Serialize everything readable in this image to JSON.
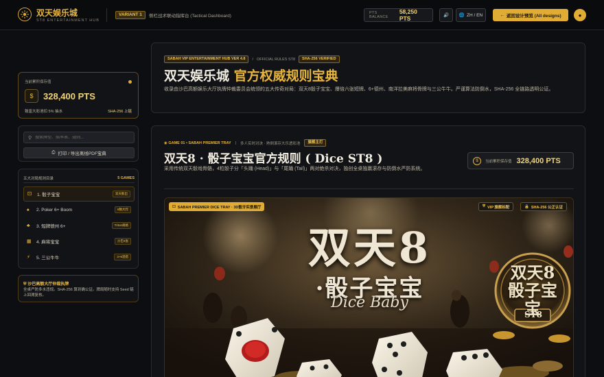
{
  "topbar": {
    "brand_title": "双天娱乐城",
    "brand_sub": "ST8 ENTERTAINMENT HUB",
    "variant": "VARIANT 1",
    "variant_desc": "侧栏战术联动指挥台 (Tactical Dashboard)",
    "balance_label": "PTS BALANCE",
    "balance_value": "58,250 PTS",
    "lang_label": "ZH / EN",
    "back_label": "返回设计预览 (All designs)"
  },
  "sidebar": {
    "balance_label": "当前累积保存值",
    "balance_value": "328,400 PTS",
    "balance_note": "致富大彩池扣 5% 抽水",
    "balance_verify": "SHA-256 上链",
    "search_placeholder": "搜索牌型、赔率表、规则...",
    "print_label": "打印 / 导出离线PDF宝典",
    "nav_title": "五大对局规则目录",
    "nav_count": "5 GAMES",
    "items": [
      {
        "label": "1. 骰子宝宝",
        "tag": "双天骰出",
        "icon": "dice-icon"
      },
      {
        "label": "2. Poker 6+ Boom",
        "tag": "6数大炸",
        "icon": "spade-icon"
      },
      {
        "label": "3. 短牌德州 6+",
        "tag": "Triton规格",
        "icon": "club-icon"
      },
      {
        "label": "4. 麻将宝宝",
        "tag": "沙巴4张",
        "icon": "grid-icon"
      },
      {
        "label": "5. 三公牛牛",
        "tag": "3+6混搭",
        "icon": "bolt-icon"
      }
    ],
    "note_title": "沙巴高额大厅仲裁执牌",
    "note_text": "全桌严防多水违规。SHA-256 算到确公证。牌局随时支持 Seed 链上回溯复核。"
  },
  "header": {
    "pill1": "SABAH VIP ENTERTAINMENT HUB VER 4.8",
    "crumb": "OFFICIAL RULES ST8",
    "pill2": "SHA-256 VERIFIED",
    "title_main": "双天娱乐城",
    "title_accent": "官方权威规则宝典",
    "desc": "收录由沙巴高额娱乐大厅执牌仲裁委员会统领的五大传奇对局：双天8骰子宝宝、爆倍六张短牌、6+德州、南洋拉美麻将骨牌与三公牛牛。严谨算法防倒水，SHA-256 全链路透明公证。"
  },
  "game": {
    "tag": "GAME 01 • SABAH PREMIER TRAY",
    "mode": "多人实时对决 · 熟倒滚存大乐透彩池",
    "pill": "旗舰主打",
    "title": "双天8 · 骰子宝宝官方规则 ( Dice ST8 )",
    "desc": "采用传统双天骰戏骨骼，4粒骰子分「头踊 (Head)」与「尾踊 (Tail)」两对绝杀对决，独创全桌独赢滚存与防倒水严防系统。",
    "balance_label": "当前累积保存值",
    "balance_value": "328,400 PTS"
  },
  "hero": {
    "tray_label": "SABAH PREMIER DICE TRAY · 3D骰牙实景展厅",
    "vip_label": "VIP 旗舰标配",
    "sha_label": "SHA-256 公正认证",
    "big_title": "双天8",
    "sub_title": "·骰子宝宝",
    "script": "Dice Baby",
    "badge_title": "双天8 骰子宝宝",
    "badge_code": "ST8"
  },
  "colors": {
    "accent": "#e8b63c",
    "background": "#0d0e11",
    "card": "#121317",
    "gold_light": "#f1d47a"
  }
}
